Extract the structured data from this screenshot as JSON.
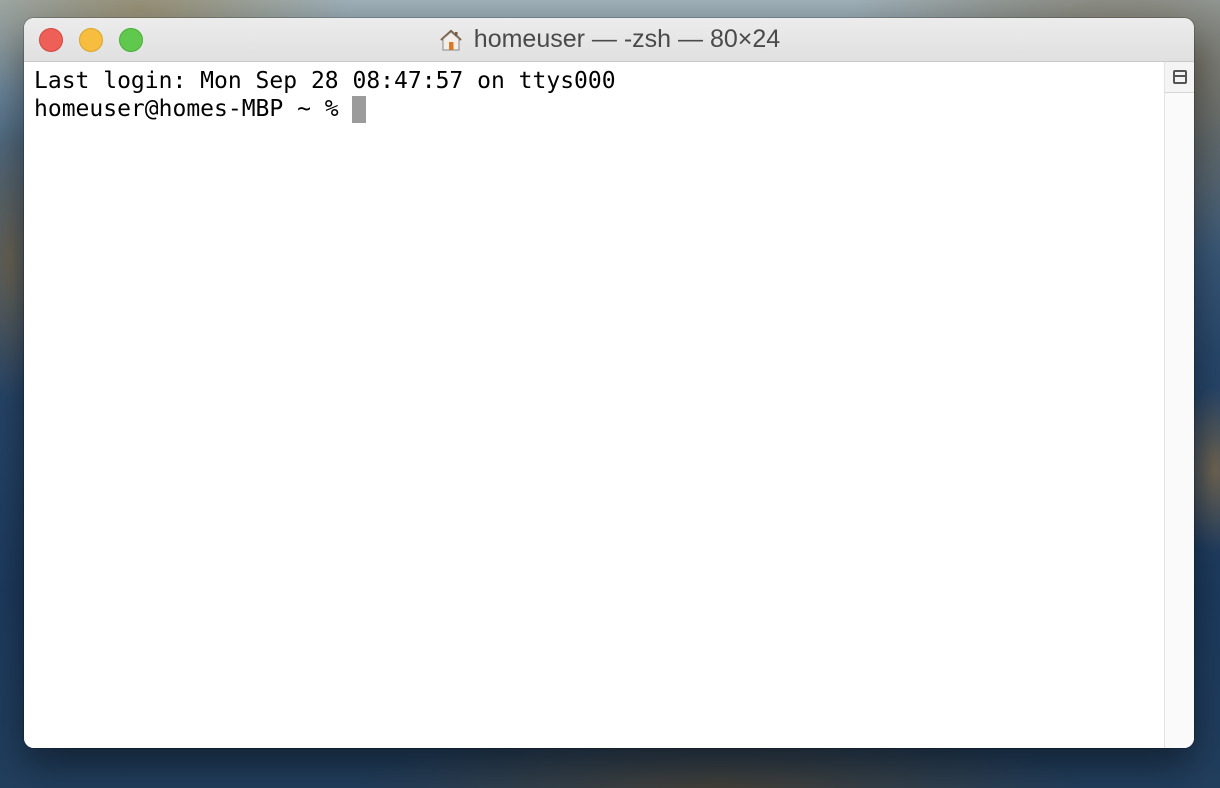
{
  "window": {
    "title": "homeuser — -zsh — 80×24",
    "title_icon": "home-folder-icon"
  },
  "terminal": {
    "lines": [
      "Last login: Mon Sep 28 08:47:57 on ttys000",
      "homeuser@homes-MBP ~ %"
    ]
  },
  "controls": {
    "close_color": "#ee5f57",
    "minimize_color": "#f6bd3f",
    "zoom_color": "#5fc84d",
    "split_icon": "split-pane-icon"
  }
}
